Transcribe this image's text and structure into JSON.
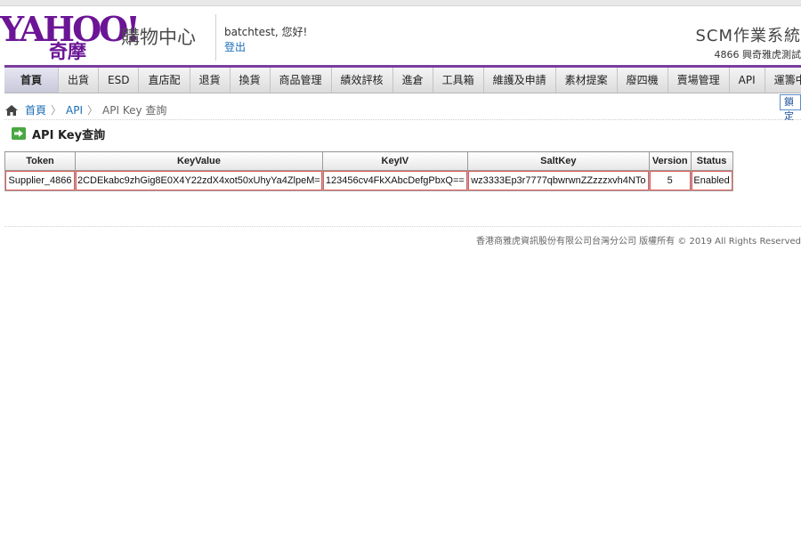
{
  "header": {
    "logo_text": "YAHOO!",
    "logo_sub": "奇摩",
    "shop_name": "購物中心",
    "user_greeting": "batchtest, 您好!",
    "logout_label": "登出",
    "system_title": "SCM作業系統",
    "vendor_info": "4866  興奇雅虎測試"
  },
  "nav": {
    "items": [
      "首頁",
      "出貨",
      "ESD",
      "直店配",
      "退貨",
      "換貨",
      "商品管理",
      "績效評核",
      "進倉",
      "工具箱",
      "維護及申請",
      "素材提案",
      "廢四機",
      "賣場管理",
      "API",
      "運籌中心"
    ]
  },
  "breadcrumb": {
    "home": "首頁",
    "api": "API",
    "current": "API Key 查詢",
    "separator": "〉"
  },
  "lock_button": "鎖定",
  "page_title": "API Key查詢",
  "table": {
    "columns": [
      "Token",
      "KeyValue",
      "KeyIV",
      "SaltKey",
      "Version",
      "Status"
    ],
    "rows": [
      {
        "token": "Supplier_4866",
        "key_value": "2CDEkabc9zhGig8E0X4Y22zdX4xot50xUhyYa4ZlpeM=",
        "key_iv": "123456cv4FkXAbcDefgPbxQ==",
        "salt_key": "wz3333Ep3r7777qbwrwnZZzzzxvh4NTo",
        "version": "5",
        "status": "Enabled"
      }
    ]
  },
  "footer": {
    "copyright": "香港商雅虎資訊股份有限公司台灣分公司  版權所有 © 2019 All Rights Reserved"
  },
  "colors": {
    "brand_purple": "#6b1596",
    "link_blue": "#1b6db5",
    "status_green": "#1a7a2a",
    "highlight_red": "#e05a5a"
  }
}
